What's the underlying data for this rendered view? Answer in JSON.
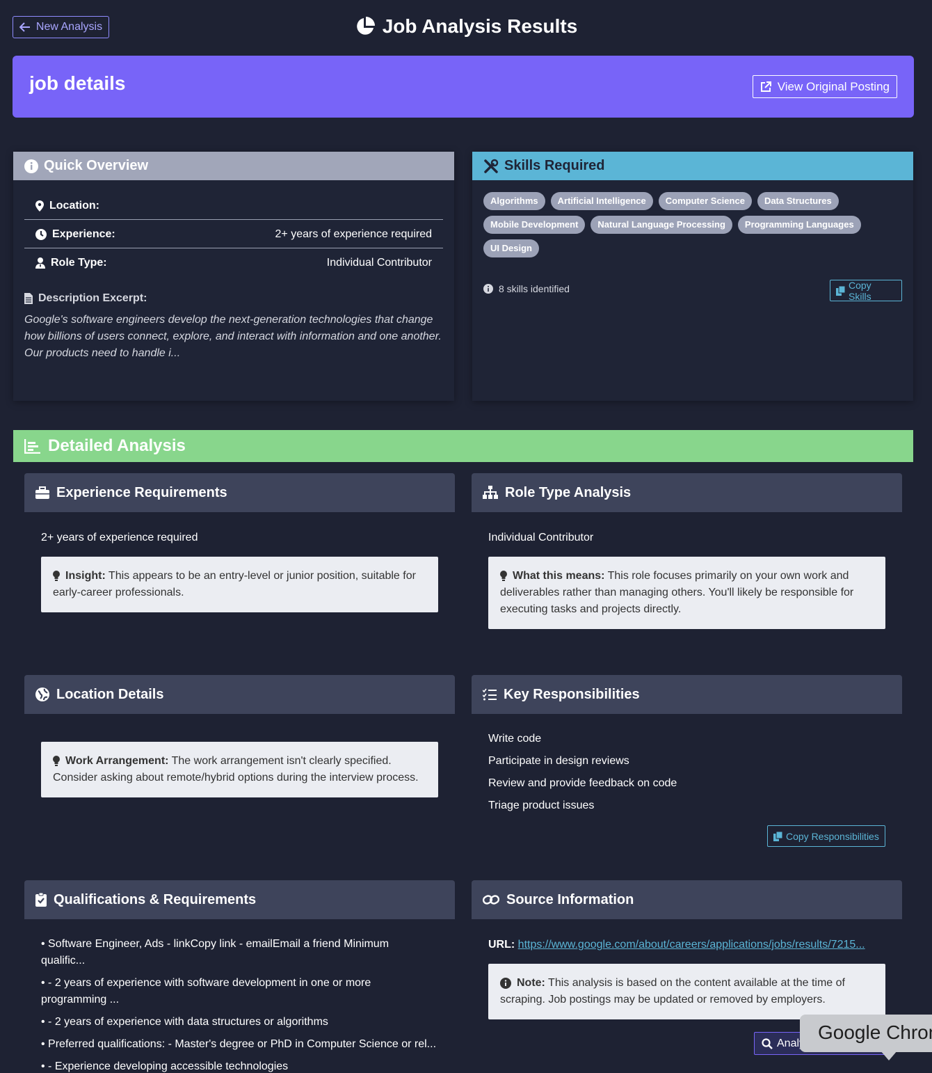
{
  "header": {
    "back_label": "New Analysis",
    "title": "Job Analysis Results"
  },
  "banner": {
    "title": "job details",
    "view_label": "View Original Posting"
  },
  "overview": {
    "title": "Quick Overview",
    "location_label": "Location:",
    "location_value": "",
    "experience_label": "Experience:",
    "experience_value": "2+ years of experience required",
    "role_label": "Role Type:",
    "role_value": "Individual Contributor",
    "desc_label": "Description Excerpt:",
    "desc_text": "Google's software engineers develop the next-generation technologies that change how billions of users connect, explore, and interact with information and one another. Our products need to handle i..."
  },
  "skills": {
    "title": "Skills Required",
    "tags": [
      "Algorithms",
      "Artificial Intelligence",
      "Computer Science",
      "Data Structures",
      "Mobile Development",
      "Natural Language Processing",
      "Programming Languages",
      "UI Design"
    ],
    "count_text": "8 skills identified",
    "copy_label": "Copy Skills"
  },
  "detailed": {
    "title": "Detailed Analysis",
    "experience": {
      "title": "Experience Requirements",
      "value": "2+ years of experience required",
      "note_label": "Insight:",
      "note_text": " This appears to be an entry-level or junior position, suitable for early-career professionals."
    },
    "role": {
      "title": "Role Type Analysis",
      "value": "Individual Contributor",
      "note_label": "What this means:",
      "note_text": " This role focuses primarily on your own work and deliverables rather than managing others. You'll likely be responsible for executing tasks and projects directly."
    },
    "location": {
      "title": "Location Details",
      "note_label": "Work Arrangement:",
      "note_text": " The work arrangement isn't clearly specified. Consider asking about remote/hybrid options during the interview process."
    },
    "responsibilities": {
      "title": "Key Responsibilities",
      "items": [
        "Write code",
        "Participate in design reviews",
        "Review and provide feedback on code",
        "Triage product issues"
      ],
      "copy_label": "Copy Responsibilities"
    },
    "qualifications": {
      "title": "Qualifications & Requirements",
      "items": [
        "• Software Engineer, Ads - linkCopy link - emailEmail a friend Minimum qualific...",
        "• - 2 years of experience with software development in one or more programming ...",
        "• - 2 years of experience with data structures or algorithms",
        "• Preferred qualifications: - Master's degree or PhD in Computer Science or rel...",
        "• - Experience developing accessible technologies"
      ]
    },
    "source": {
      "title": "Source Information",
      "url_label": "URL:",
      "url": "https://www.google.com/about/careers/applications/jobs/results/7215...",
      "note_label": "Note:",
      "note_text": " This analysis is based on the content available at the time of scraping. Job postings may be updated or removed by employers.",
      "analyze_label": "Analyze Another"
    }
  },
  "tooltip": {
    "text": "Google Chrome"
  }
}
